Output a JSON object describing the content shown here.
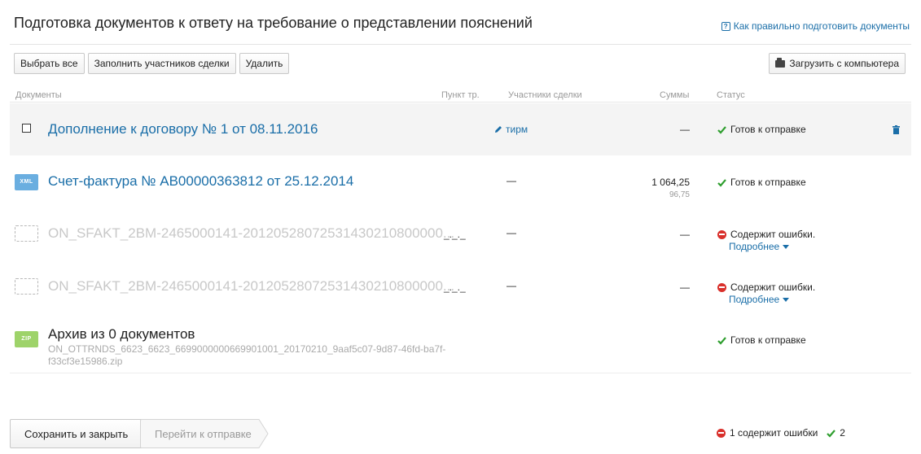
{
  "header": {
    "title": "Подготовка документов к ответу на требование о представлении пояснений",
    "help_link": "Как правильно подготовить документы"
  },
  "toolbar": {
    "select_all": "Выбрать все",
    "fill_participants": "Заполнить участников сделки",
    "delete": "Удалить",
    "upload": "Загрузить с компьютера"
  },
  "columns": {
    "documents": "Документы",
    "point": "Пункт тр.",
    "participants": "Участники сделки",
    "sums": "Суммы",
    "status": "Статус"
  },
  "rows": [
    {
      "name": "Дополнение к договору № 1 от 08.11.2016",
      "participants": "тирм",
      "sum": "—",
      "status": "Готов к отправке",
      "selected": true
    },
    {
      "badge": "XML",
      "name": "Счет-фактура № АВ00000363812 от 25.12.2014",
      "participants": "—",
      "sum": "1 064,25",
      "sum_vat": "96,75",
      "status": "Готов к отправке"
    },
    {
      "name": "ON_SFAKT_2BM-2465000141-20120528072531430210800000...",
      "point": "_._._",
      "participants": "—",
      "sum": "—",
      "status": "Содержит ошибки.",
      "details": "Подробнее"
    },
    {
      "name": "ON_SFAKT_2BM-2465000141-20120528072531430210800000...",
      "point": "_._._",
      "participants": "—",
      "sum": "—",
      "status": "Содержит ошибки.",
      "details": "Подробнее"
    },
    {
      "badge": "ZIP",
      "name": "Архив из 0 документов",
      "filename": "ON_OTTRNDS_6623_6623_6699000000669901001_20170210_9aaf5c07-9d87-46fd-ba7f-f33cf3e15986.zip",
      "status": "Готов к отправке"
    }
  ],
  "footer": {
    "save_close": "Сохранить и закрыть",
    "go_to_send": "Перейти к отправке",
    "errors_summary": "1 содержит ошибки",
    "ready_count": "2"
  },
  "colors": {
    "link": "#1a6ea8",
    "success": "#2e9e2e",
    "error": "#d9302b",
    "xml_badge": "#6aaee0",
    "zip_badge": "#9ed36a"
  }
}
